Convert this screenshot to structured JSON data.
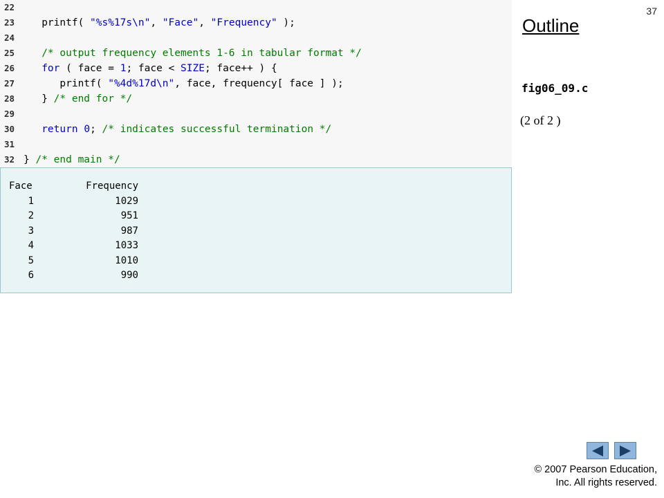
{
  "code": {
    "lines": [
      {
        "num": "22",
        "tokens": []
      },
      {
        "num": "23",
        "tokens": [
          {
            "t": "   printf( ",
            "c": "p"
          },
          {
            "t": "\"%s%17s\\n\"",
            "c": "s"
          },
          {
            "t": ", ",
            "c": "p"
          },
          {
            "t": "\"Face\"",
            "c": "s"
          },
          {
            "t": ", ",
            "c": "p"
          },
          {
            "t": "\"Frequency\"",
            "c": "s"
          },
          {
            "t": " );",
            "c": "p"
          }
        ]
      },
      {
        "num": "24",
        "tokens": []
      },
      {
        "num": "25",
        "tokens": [
          {
            "t": "   /* output frequency elements 1-6 in tabular format */",
            "c": "c"
          }
        ]
      },
      {
        "num": "26",
        "tokens": [
          {
            "t": "   ",
            "c": "p"
          },
          {
            "t": "for",
            "c": "k"
          },
          {
            "t": " ( face = ",
            "c": "p"
          },
          {
            "t": "1",
            "c": "k"
          },
          {
            "t": "; face < ",
            "c": "p"
          },
          {
            "t": "SIZE",
            "c": "k"
          },
          {
            "t": "; face++ ) {",
            "c": "p"
          }
        ]
      },
      {
        "num": "27",
        "tokens": [
          {
            "t": "      printf( ",
            "c": "p"
          },
          {
            "t": "\"%4d%17d\\n\"",
            "c": "s"
          },
          {
            "t": ", face, frequency[ face ] );",
            "c": "p"
          }
        ]
      },
      {
        "num": "28",
        "tokens": [
          {
            "t": "   } ",
            "c": "p"
          },
          {
            "t": "/* end for */",
            "c": "c"
          }
        ]
      },
      {
        "num": "29",
        "tokens": []
      },
      {
        "num": "30",
        "tokens": [
          {
            "t": "   ",
            "c": "p"
          },
          {
            "t": "return",
            "c": "k"
          },
          {
            "t": " ",
            "c": "p"
          },
          {
            "t": "0",
            "c": "k"
          },
          {
            "t": "; ",
            "c": "p"
          },
          {
            "t": "/* indicates successful termination */",
            "c": "c"
          }
        ]
      },
      {
        "num": "31",
        "tokens": []
      },
      {
        "num": "32",
        "tokens": [
          {
            "t": "} ",
            "c": "p"
          },
          {
            "t": "/* end main */",
            "c": "c"
          }
        ]
      }
    ]
  },
  "output": {
    "header": {
      "face": "Face",
      "freq": "Frequency"
    },
    "rows": [
      {
        "face": "1",
        "freq": "1029"
      },
      {
        "face": "2",
        "freq": "951"
      },
      {
        "face": "3",
        "freq": "987"
      },
      {
        "face": "4",
        "freq": "1033"
      },
      {
        "face": "5",
        "freq": "1010"
      },
      {
        "face": "6",
        "freq": "990"
      }
    ]
  },
  "sidebar": {
    "slide_number": "37",
    "outline_title": "Outline",
    "file_name": "fig06_09.c",
    "page_count": "(2 of 2 )"
  },
  "nav": {
    "prev_icon": "triangle-left-icon",
    "next_icon": "triangle-right-icon",
    "icon_color": "#1a3e66"
  },
  "footer": {
    "copyright_symbol": "©",
    "copyright_line1": " 2007 Pearson Education,",
    "copyright_line2": "Inc.  All rights reserved."
  }
}
